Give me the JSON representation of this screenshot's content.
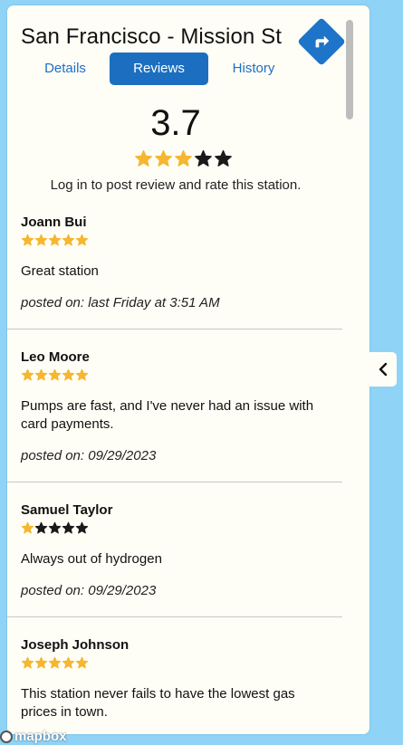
{
  "station": {
    "title": "San Francisco - Mission St"
  },
  "tabs": [
    {
      "label": "Details"
    },
    {
      "label": "Reviews",
      "active": true
    },
    {
      "label": "History"
    }
  ],
  "summary": {
    "rating": "3.7",
    "rating_value": 3.7,
    "stars_filled": 3,
    "stars_total": 5,
    "login_note": "Log in to post review and rate this station."
  },
  "reviews": [
    {
      "name": "Joann Bui",
      "stars": 5,
      "text": "Great station",
      "date": "posted on: last Friday at 3:51 AM"
    },
    {
      "name": "Leo Moore",
      "stars": 5,
      "text": "Pumps are fast, and I've never had an issue with card payments.",
      "date": "posted on: 09/29/2023"
    },
    {
      "name": "Samuel Taylor",
      "stars": 1,
      "text": "Always out of hydrogen",
      "date": "posted on: 09/29/2023"
    },
    {
      "name": "Joseph Johnson",
      "stars": 5,
      "text": "This station never fails to have the lowest gas prices in town.",
      "date": ""
    }
  ],
  "map": {
    "attribution": "mapbox"
  },
  "colors": {
    "accent": "#1c6fc0",
    "star_filled": "#f5b731",
    "star_empty": "#1a1a1a",
    "panel_bg": "#fffef6",
    "map_bg": "#8fd3f7"
  },
  "icons": {
    "directions": "directions-arrow-icon",
    "collapse": "chevron-left-icon",
    "star": "star-icon"
  }
}
